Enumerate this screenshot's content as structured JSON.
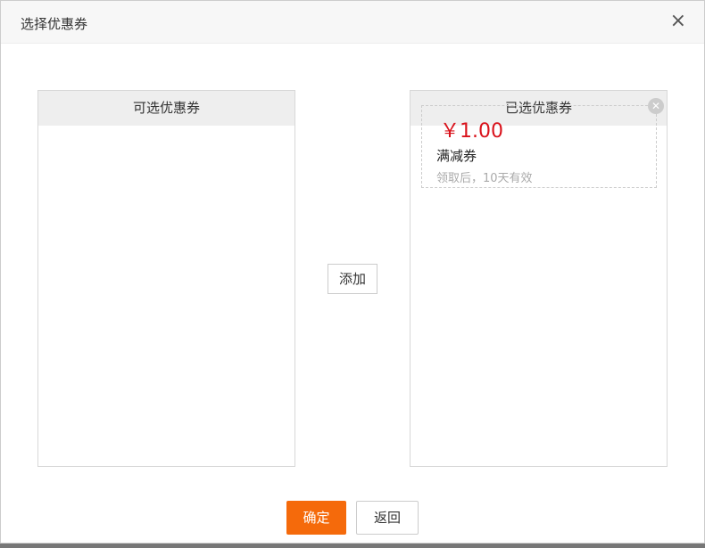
{
  "dialog": {
    "title": "选择优惠券",
    "close_icon": "×"
  },
  "left_panel": {
    "title": "可选优惠券"
  },
  "right_panel": {
    "title": "已选优惠券",
    "coupons": [
      {
        "price": "￥1.00",
        "type": "满减券",
        "validity": "领取后，10天有效"
      }
    ]
  },
  "add_label": "添加",
  "footer": {
    "confirm": "确定",
    "back": "返回"
  },
  "colors": {
    "accent": "#f56a0b",
    "price": "#d9121b"
  }
}
